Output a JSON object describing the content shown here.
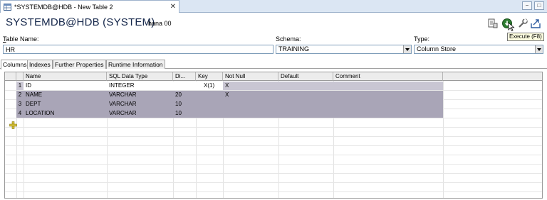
{
  "tab": {
    "title": "*SYSTEMDB@HDB - New Table 2",
    "icon": "table-icon",
    "close_glyph": "✕"
  },
  "window_controls": {
    "minimize": "−",
    "maximize": "□"
  },
  "header": {
    "title": "SYSTEMDB@HDB (SYSTEM)",
    "system": "hana 00",
    "toolbar_icons": [
      "sql-console-icon",
      "execute-icon",
      "wrench-icon",
      "export-icon"
    ],
    "tooltip": "Execute (F8)"
  },
  "form": {
    "table_name_label_underlined": "T",
    "table_name_label_rest": "able Name:",
    "table_name_value": "HR",
    "schema_label": "Schema:",
    "schema_value": "TRAINING",
    "type_label": "Type:",
    "type_value": "Column Store"
  },
  "subtabs": [
    "Columns",
    "Indexes",
    "Further Properties",
    "Runtime Information"
  ],
  "grid": {
    "headers": [
      "Name",
      "SQL Data Type",
      "Di...",
      "Key",
      "Not Null",
      "Default",
      "Comment"
    ],
    "rows": [
      {
        "num": "1",
        "name": "ID",
        "type": "INTEGER",
        "dim": "",
        "key": "X(1)",
        "notnull": "X",
        "default": "",
        "comment": ""
      },
      {
        "num": "2",
        "name": "NAME",
        "type": "VARCHAR",
        "dim": "20",
        "key": "",
        "notnull": "X",
        "default": "",
        "comment": ""
      },
      {
        "num": "3",
        "name": "DEPT",
        "type": "VARCHAR",
        "dim": "10",
        "key": "",
        "notnull": "",
        "default": "",
        "comment": ""
      },
      {
        "num": "4",
        "name": "LOCATION",
        "type": "VARCHAR",
        "dim": "10",
        "key": "",
        "notnull": "",
        "default": "",
        "comment": ""
      }
    ],
    "add_row_icon": "plus-icon"
  },
  "colors": {
    "title": "#14264a",
    "selection": "#a9a5b7",
    "tab_bar": "#dbe6f3",
    "tooltip_bg": "#ffffe1"
  }
}
